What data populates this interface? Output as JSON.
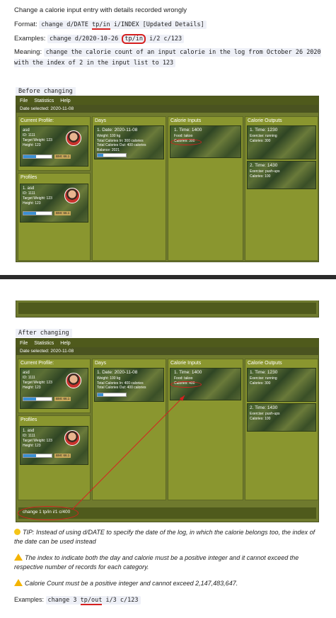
{
  "intro": "Change a calorie input entry with details recorded wrongly",
  "format_label": "Format:",
  "format_code_1": "change d/DATE ",
  "format_code_2": "tp/in",
  "format_code_3": " i/INDEX [Updated Details]",
  "examples_label": "Examples:",
  "example_code_1": "change d/2020-10-26 ",
  "example_code_2": "tp/in",
  "example_code_3": " i/2 c/123",
  "meaning_label": "Meaning:",
  "meaning_code": "change the calorie count of an input calorie in the log from October 26 2020 with the index of 2 in the input list to 123",
  "before_label": "Before changing",
  "after_label": "After changing",
  "app": {
    "menu": [
      "File",
      "Statistics",
      "Help"
    ],
    "date_selected": "Date selected: 2020-11-08",
    "current_profile_title": "Current Profile:",
    "profiles_title": "Profiles",
    "days_title": "Days",
    "inputs_title": "Calorie Inputs",
    "outputs_title": "Calorie Outputs",
    "profile_name": "asd",
    "profile_id": "ID: 1111",
    "profile_target": "Target Weight: 123",
    "profile_height": "Height: 123",
    "profile_bmi": "BMI: 66.1",
    "profiles_item_name": "1.  asd",
    "day_date": "1.  Date: 2020-11-08",
    "day_weight": "Weight: 100 kg",
    "day_total_out": "Total Calories Out: 400 calories",
    "before": {
      "day_total_in": "Total Calories In: 300 calories",
      "day_balance": "Balance: 2021",
      "input_calories": "Calories: 300"
    },
    "after": {
      "day_total_in": "Total Calories In: 400 calories",
      "input_calories": "Calories: 400"
    },
    "input_time": "1.  Time: 1400",
    "input_food": "Food: takoo",
    "output_1_time": "1.  Time: 1230",
    "output_1_exercise": "Exercise: running",
    "output_1_calories": "Calories: 300",
    "output_2_time": "2.  Time: 1430",
    "output_2_exercise": "Exercise: push-ups",
    "output_2_calories": "Calories: 100",
    "command_text": "change 1 tp/in i/1 c/400"
  },
  "tip": "TIP: Instead of using d/DATE to specify the date of the log, in which the calorie belongs too, the index of the date can be used instead",
  "warn_1": "The index to indicate both the day and calorie must be a positive integer and it cannot exceed the respective number of records for each category.",
  "warn_2": "Calorie Count must be a positive integer and cannot exceed 2,147,483,647.",
  "examples_2_label": "Examples:",
  "example2_code_1": "change 3 ",
  "example2_code_2": "tp/out",
  "example2_code_3": " i/3 c/123",
  "colors": {
    "annotation_red": "#d62020",
    "app_green": "#6f7a2e",
    "menu_dark": "#4f5a1c"
  },
  "icons": [
    "bulb-icon",
    "warning-icon"
  ]
}
